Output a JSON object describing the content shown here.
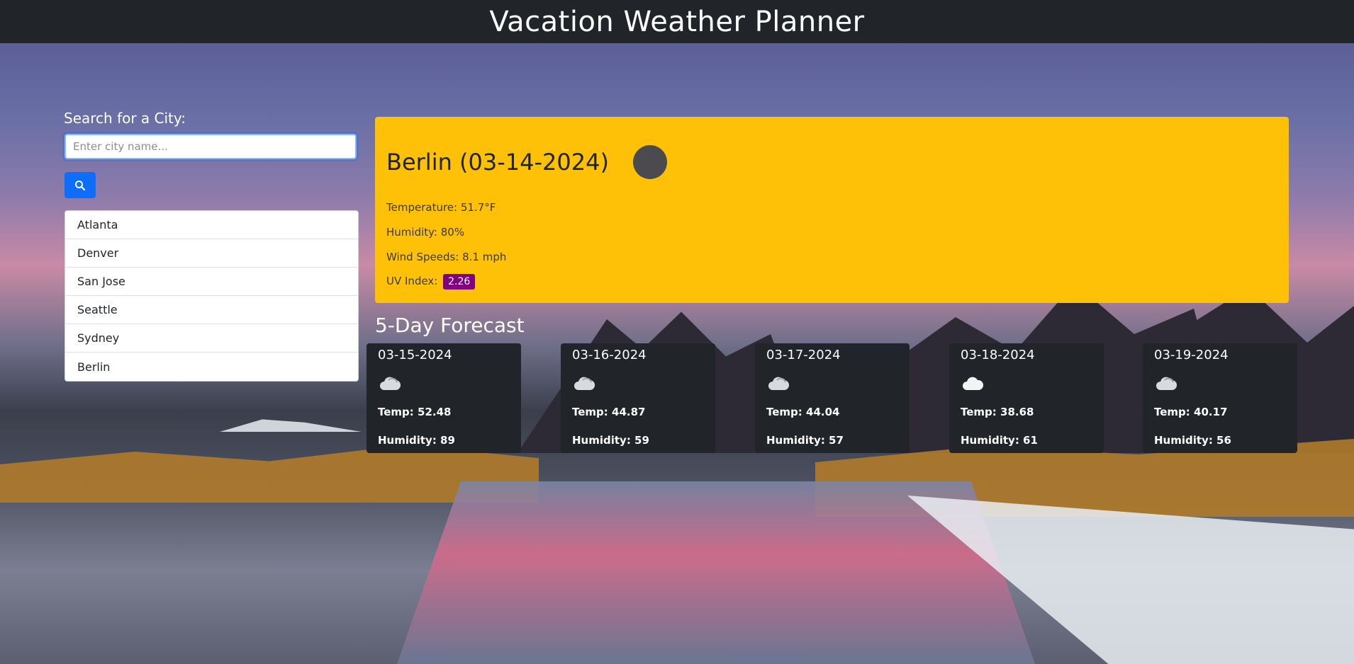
{
  "header": {
    "title": "Vacation Weather Planner"
  },
  "search": {
    "label": "Search for a City:",
    "placeholder": "Enter city name...",
    "value": "",
    "button_icon": "search-icon"
  },
  "history": [
    "Atlanta",
    "Denver",
    "San Jose",
    "Seattle",
    "Sydney",
    "Berlin"
  ],
  "current": {
    "title": "Berlin (03-14-2024)",
    "icon": "weather-icon",
    "temperature": "Temperature: 51.7°F",
    "humidity": "Humidity: 80%",
    "wind": "Wind Speeds: 8.1 mph",
    "uv_label": "UV Index:",
    "uv_value": "2.26",
    "uv_color": "#800080",
    "accent_color": "#ffc107"
  },
  "forecast": {
    "title": "5-Day Forecast",
    "days": [
      {
        "date": "03-15-2024",
        "icon": "cloud-icon",
        "temp": "Temp: 52.48",
        "humidity": "Humidity: 89"
      },
      {
        "date": "03-16-2024",
        "icon": "cloud-icon",
        "temp": "Temp: 44.87",
        "humidity": "Humidity: 59"
      },
      {
        "date": "03-17-2024",
        "icon": "cloud-icon",
        "temp": "Temp: 44.04",
        "humidity": "Humidity: 57"
      },
      {
        "date": "03-18-2024",
        "icon": "cloud-icon",
        "temp": "Temp: 38.68",
        "humidity": "Humidity: 61"
      },
      {
        "date": "03-19-2024",
        "icon": "cloud-icon",
        "temp": "Temp: 40.17",
        "humidity": "Humidity: 56"
      }
    ]
  }
}
